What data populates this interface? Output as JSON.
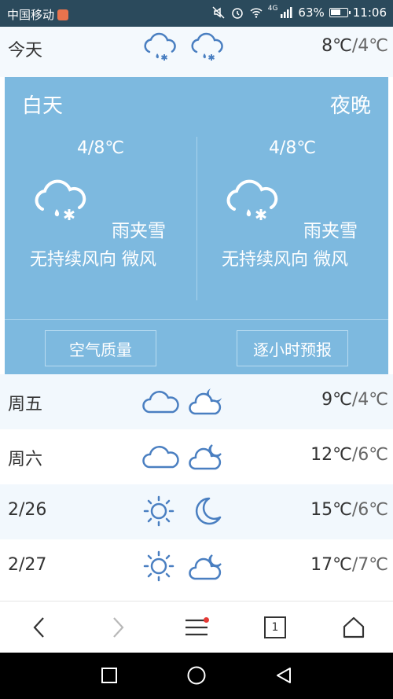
{
  "status_bar": {
    "carrier": "中国移动",
    "network": "4G",
    "battery": "63%",
    "battery_level": 0.63,
    "time": "11:06"
  },
  "today": {
    "label": "今天",
    "temp_high": "8℃",
    "temp_sep": "/",
    "temp_low": "4℃",
    "icons": [
      "sleet-icon",
      "sleet-icon"
    ]
  },
  "detail": {
    "day": {
      "title": "白天",
      "temp": "4/8℃",
      "condition": "雨夹雪",
      "wind": "无持续风向 微风",
      "icon": "sleet-icon"
    },
    "night": {
      "title": "夜晚",
      "temp": "4/8℃",
      "condition": "雨夹雪",
      "wind": "无持续风向 微风",
      "icon": "sleet-icon"
    },
    "air_quality_label": "空气质量",
    "hourly_label": "逐小时预报"
  },
  "forecast": [
    {
      "label": "周五",
      "temp_high": "9℃",
      "temp_low": "4℃",
      "icons": [
        "cloudy-icon",
        "cloudy-night-icon"
      ]
    },
    {
      "label": "周六",
      "temp_high": "12℃",
      "temp_low": "6℃",
      "icons": [
        "cloudy-icon",
        "cloudy-night-icon"
      ]
    },
    {
      "label": "2/26",
      "temp_high": "15℃",
      "temp_low": "6℃",
      "icons": [
        "sunny-icon",
        "moon-icon"
      ]
    },
    {
      "label": "2/27",
      "temp_high": "17℃",
      "temp_low": "7℃",
      "icons": [
        "sunny-icon",
        "cloudy-night-icon"
      ]
    }
  ],
  "bottom_nav": {
    "tab_count": "1",
    "icons": [
      "back-icon",
      "forward-icon",
      "menu-icon",
      "tabs-icon",
      "home-icon"
    ]
  },
  "colors": {
    "status_bar": "#2b4a5c",
    "panel": "#7db9df",
    "icon_blue": "#4a7fc1",
    "row_alt": "#f2f8fd",
    "badge": "#e53935"
  }
}
